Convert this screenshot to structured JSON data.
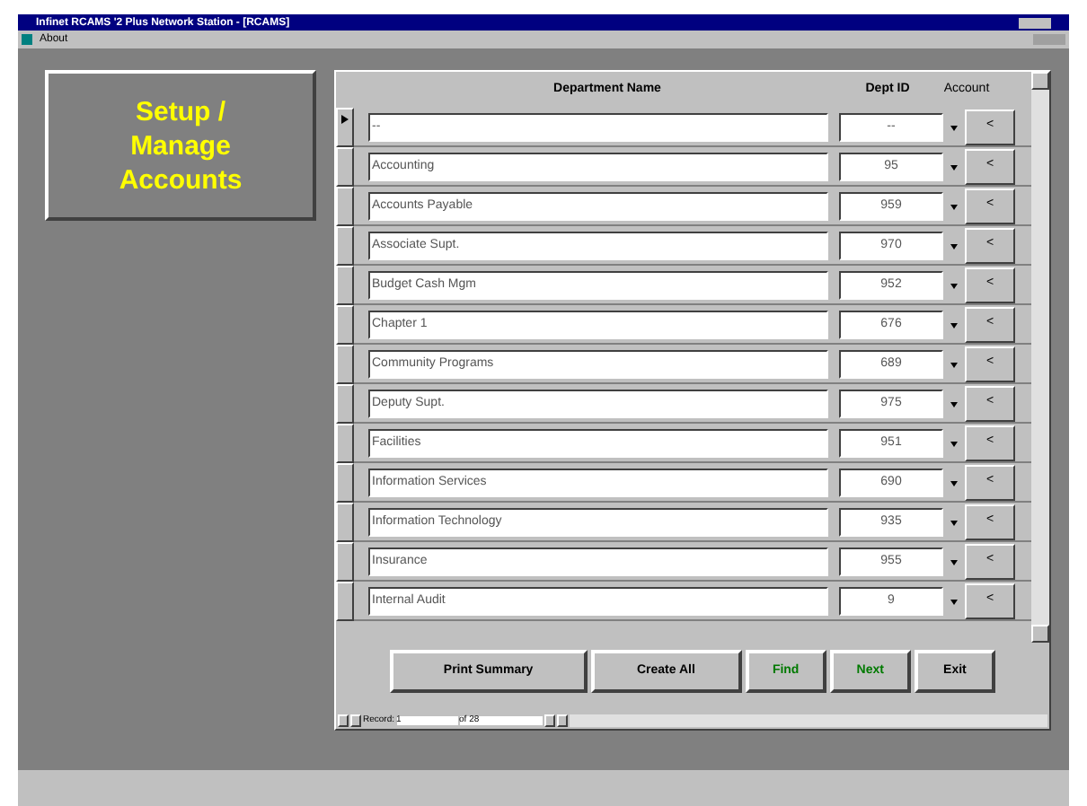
{
  "window": {
    "title": "Infinet RCAMS '2 Plus Network Station - [RCAMS]"
  },
  "menu": [
    "About"
  ],
  "heading": "Setup / Manage Accounts",
  "table": {
    "columns": [
      "Department Name",
      "Dept ID",
      "Account"
    ],
    "rows": [
      {
        "name": "--",
        "id": "--",
        "button": "<",
        "selected": true
      },
      {
        "name": "Accounting",
        "id": "95",
        "button": "<",
        "selected": false
      },
      {
        "name": "Accounts Payable",
        "id": "959",
        "button": "<",
        "selected": false
      },
      {
        "name": "Associate Supt.",
        "id": "970",
        "button": "<",
        "selected": false
      },
      {
        "name": "Budget Cash Mgm",
        "id": "952",
        "button": "<",
        "selected": false
      },
      {
        "name": "Chapter 1",
        "id": "676",
        "button": "<",
        "selected": false
      },
      {
        "name": "Community Programs",
        "id": "689",
        "button": "<",
        "selected": false
      },
      {
        "name": "Deputy Supt.",
        "id": "975",
        "button": "<",
        "selected": false
      },
      {
        "name": "Facilities",
        "id": "951",
        "button": "<",
        "selected": false
      },
      {
        "name": "Information Services",
        "id": "690",
        "button": "<",
        "selected": false
      },
      {
        "name": "Information Technology",
        "id": "935",
        "button": "<",
        "selected": false
      },
      {
        "name": "Insurance",
        "id": "955",
        "button": "<",
        "selected": false
      },
      {
        "name": "Internal Audit",
        "id": "9",
        "button": "<",
        "selected": false
      }
    ]
  },
  "buttons": [
    {
      "label": "Print Summary",
      "kind": "normal"
    },
    {
      "label": "Create All",
      "kind": "normal"
    },
    {
      "label": "Find",
      "kind": "green"
    },
    {
      "label": "Next",
      "kind": "green"
    },
    {
      "label": "Exit",
      "kind": "normal"
    }
  ],
  "navigator": {
    "label": "Record:",
    "value": "1",
    "total": "of 28"
  }
}
